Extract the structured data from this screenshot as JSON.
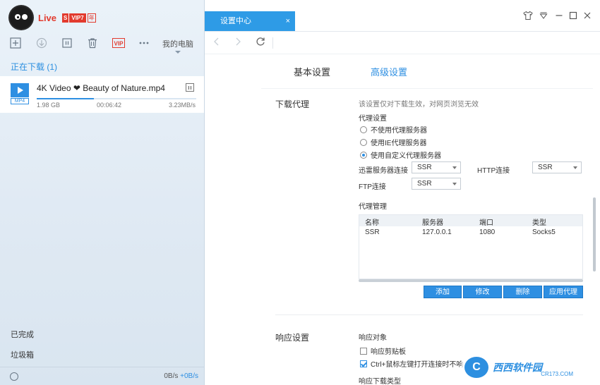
{
  "app": {
    "live_label": "Live",
    "vip_s": "S",
    "vip_level": "VIP7",
    "vip_year": "年"
  },
  "toolbar": {
    "my_pc": "我的电脑"
  },
  "downloads": {
    "heading": "正在下载 (1)",
    "item": {
      "name": "4K Video ❤ Beauty of Nature.mp4",
      "ext": "MP4",
      "size": "1.98 GB",
      "time": "00:06:42",
      "speed": "3.23MB/s",
      "progress": 0.36
    }
  },
  "sidebar_bottom": {
    "done": "已完成",
    "trash": "垃圾箱",
    "speed_down": "0B/s",
    "speed_up": "+0B/s"
  },
  "window": {
    "tab_title": "设置中心",
    "tab_close": "×"
  },
  "settings": {
    "tab_basic": "基本设置",
    "tab_advanced": "高级设置",
    "proxy": {
      "section": "下载代理",
      "hint": "该设置仅对下载生效，对网页浏览无效",
      "sub": "代理设置",
      "options": [
        "不使用代理服务器",
        "使用IE代理服务器",
        "使用自定义代理服务器"
      ],
      "selected_index": 2,
      "thunder_label": "迅雷服务器连接",
      "thunder_value": "SSR",
      "http_label": "HTTP连接",
      "http_value": "SSR",
      "ftp_label": "FTP连接",
      "ftp_value": "SSR",
      "manage_title": "代理管理",
      "table": {
        "headers": [
          "名称",
          "服务器",
          "端口",
          "类型"
        ],
        "rows": [
          [
            "SSR",
            "127.0.0.1",
            "1080",
            "Socks5"
          ]
        ]
      },
      "buttons": [
        "添加",
        "修改",
        "删除",
        "应用代理"
      ]
    },
    "response": {
      "section": "响应设置",
      "target_title": "响应对象",
      "clipboard": "响应剪贴板",
      "clipboard_checked": false,
      "ctrl_click": "Ctrl+鼠标左键打开连接时不响",
      "ctrl_click_checked": true,
      "type_title": "响应下载类型"
    }
  },
  "watermark": {
    "logo": "C",
    "text": "西西软件园",
    "url": "CR173.COM"
  }
}
